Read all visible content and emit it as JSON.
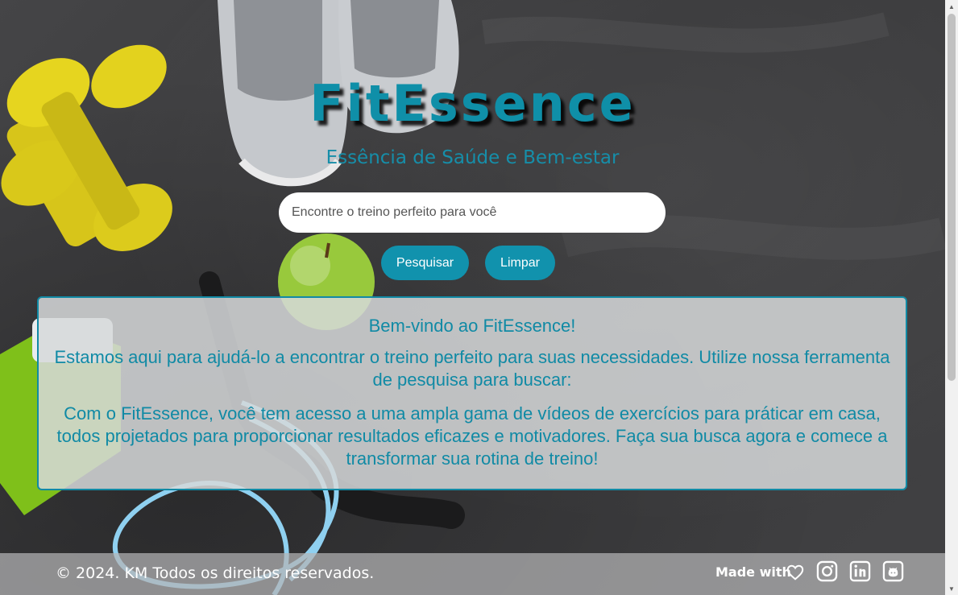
{
  "header": {
    "brand": "FitEssence",
    "tagline": "Essência de Saúde e Bem-estar"
  },
  "search": {
    "placeholder": "Encontre o treino perfeito para você",
    "value": "",
    "search_button": "Pesquisar",
    "clear_button": "Limpar"
  },
  "welcome": {
    "title": "Bem-vindo ao FitEssence!",
    "paragraph1": "Estamos aqui para ajudá-lo a encontrar o treino perfeito para suas necessidades. Utilize nossa ferramenta de pesquisa para buscar:",
    "paragraph2": "Com o FitEssence, você tem acesso a uma ampla gama de vídeos de exercícios para práticar em casa, todos projetados para proporcionar resultados eficazes e motivadores. Faça sua busca agora e comece a transformar sua rotina de treino!"
  },
  "footer": {
    "copyright": "© 2024. KM Todos os direitos reservados.",
    "made_with": "Made with",
    "icons": [
      "heart-icon",
      "instagram-icon",
      "linkedin-icon",
      "github-icon"
    ]
  },
  "colors": {
    "accent": "#1192ad",
    "panel_text": "#108aa5",
    "footer_text": "#ffffff"
  }
}
